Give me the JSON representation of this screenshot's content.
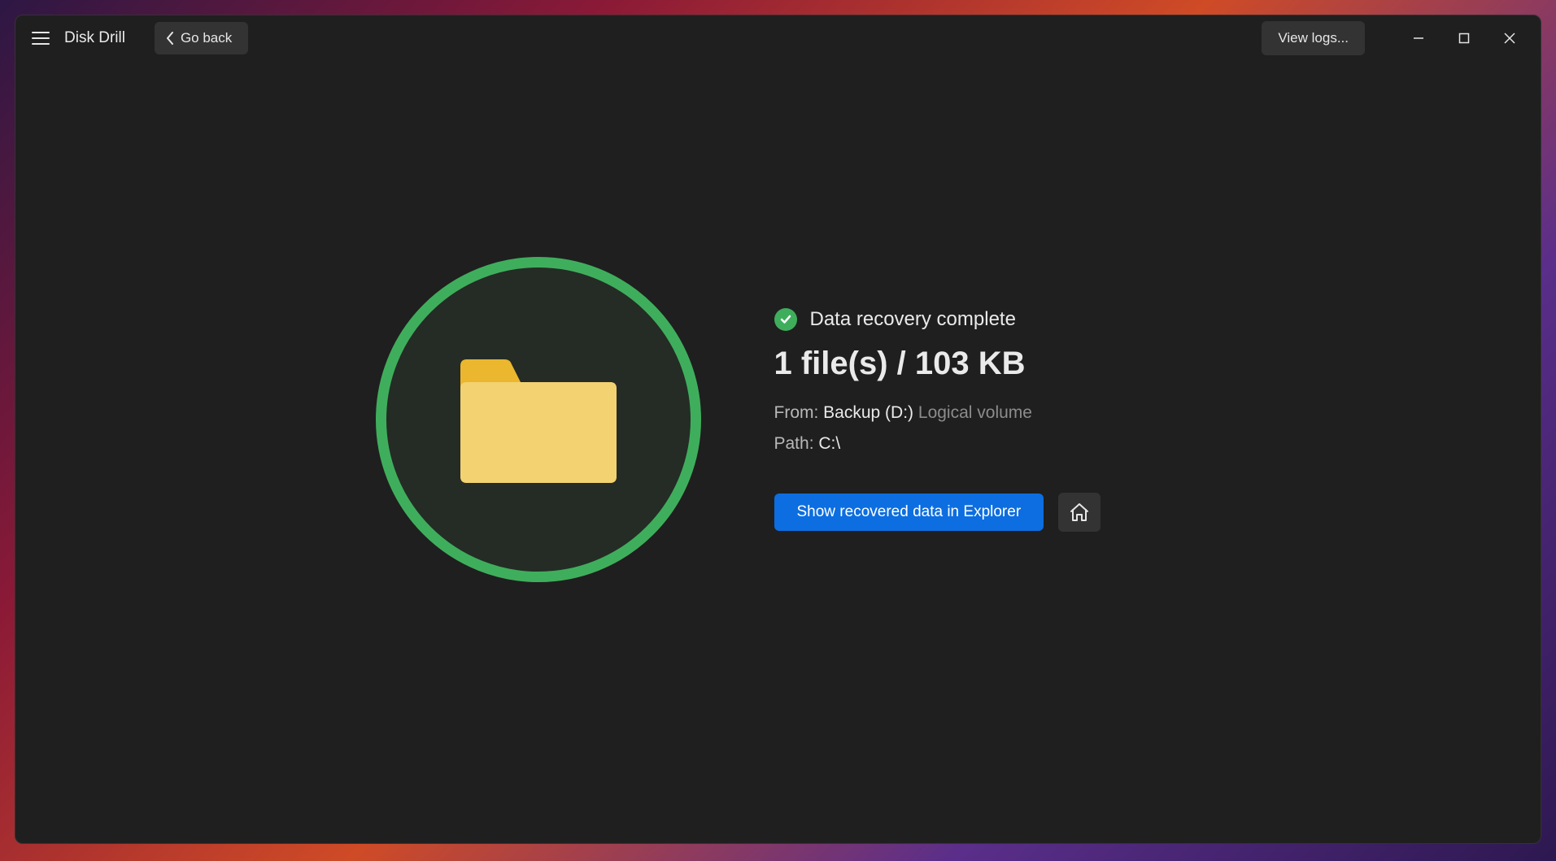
{
  "app": {
    "title": "Disk Drill"
  },
  "titlebar": {
    "go_back_label": "Go back",
    "view_logs_label": "View logs..."
  },
  "recovery": {
    "status_text": "Data recovery complete",
    "headline": "1 file(s) / 103 KB",
    "from_label": "From:",
    "from_value": "Backup (D:)",
    "from_type": "Logical volume",
    "path_label": "Path:",
    "path_value": "C:\\",
    "show_in_explorer_label": "Show recovered data in Explorer"
  },
  "colors": {
    "accent_green": "#3fae5c",
    "primary_blue": "#0c6ee0",
    "window_bg": "#1f1f1f",
    "button_grey": "#333333"
  }
}
